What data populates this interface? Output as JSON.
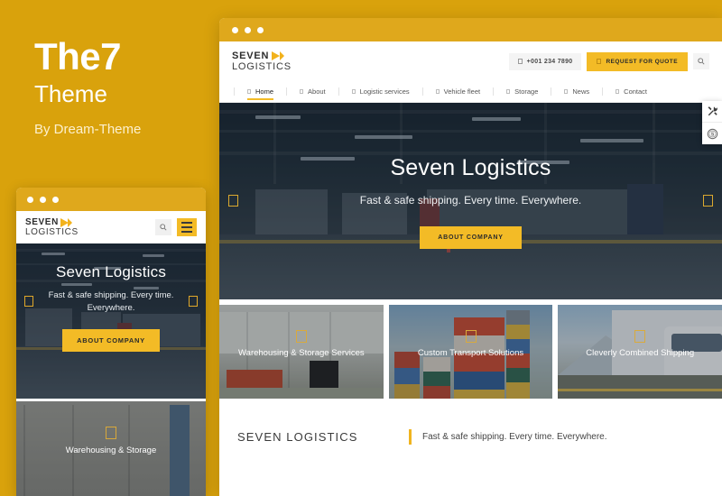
{
  "promo": {
    "title": "The7",
    "subtitle": "Theme",
    "byline": "By Dream-Theme"
  },
  "colors": {
    "page_background": "#d9a20c",
    "accent_yellow": "#f3bb26",
    "titlebar_yellow": "#dfa81c",
    "dark_text": "#2c2c2c"
  },
  "mobile": {
    "titlebar_dots": [
      "dot",
      "dot",
      "dot"
    ],
    "logo": {
      "line1": "SEVEN",
      "line2": "LOGISTICS"
    },
    "search_icon": "search-icon",
    "menu_icon": "hamburger-menu-icon",
    "hero": {
      "heading": "Seven Logistics",
      "subheading": "Fast & safe shipping. Every time. Everywhere.",
      "button": "ABOUT COMPANY",
      "prev_icon": "chevron-left-icon",
      "next_icon": "chevron-right-icon"
    },
    "card": {
      "title": "Warehousing & Storage",
      "icon": "placeholder-icon"
    }
  },
  "desktop": {
    "titlebar_dots": [
      "dot",
      "dot",
      "dot"
    ],
    "logo": {
      "line1": "SEVEN",
      "line2": "LOGISTICS"
    },
    "header": {
      "phone": "+001 234 7890",
      "phone_icon": "phone-icon",
      "quote_button": "REQUEST FOR QUOTE",
      "quote_icon": "quote-icon",
      "search_icon": "search-icon"
    },
    "nav": [
      {
        "label": "Home",
        "icon": "home-icon",
        "active": true
      },
      {
        "label": "About",
        "icon": "info-icon",
        "active": false
      },
      {
        "label": "Logistic services",
        "icon": "services-icon",
        "active": false
      },
      {
        "label": "Vehicle fleet",
        "icon": "truck-icon",
        "active": false
      },
      {
        "label": "Storage",
        "icon": "box-icon",
        "active": false
      },
      {
        "label": "News",
        "icon": "news-icon",
        "active": false
      },
      {
        "label": "Contact",
        "icon": "mail-icon",
        "active": false
      }
    ],
    "hero": {
      "heading": "Seven Logistics",
      "subheading": "Fast & safe shipping. Every time. Everywhere.",
      "button": "ABOUT COMPANY",
      "prev_icon": "chevron-left-icon",
      "next_icon": "chevron-right-icon"
    },
    "cards": [
      {
        "title": "Warehousing & Storage Services",
        "icon": "warehouse-icon"
      },
      {
        "title": "Custom Transport Solutions",
        "icon": "container-icon"
      },
      {
        "title": "Cleverly Combined Shipping",
        "icon": "truck-icon"
      }
    ],
    "footer": {
      "title": "SEVEN LOGISTICS",
      "tagline": "Fast & safe shipping. Every time. Everywhere."
    }
  },
  "tools_panel": [
    {
      "icon": "tools-wrench-icon"
    },
    {
      "icon": "coin-dollar-icon"
    }
  ]
}
